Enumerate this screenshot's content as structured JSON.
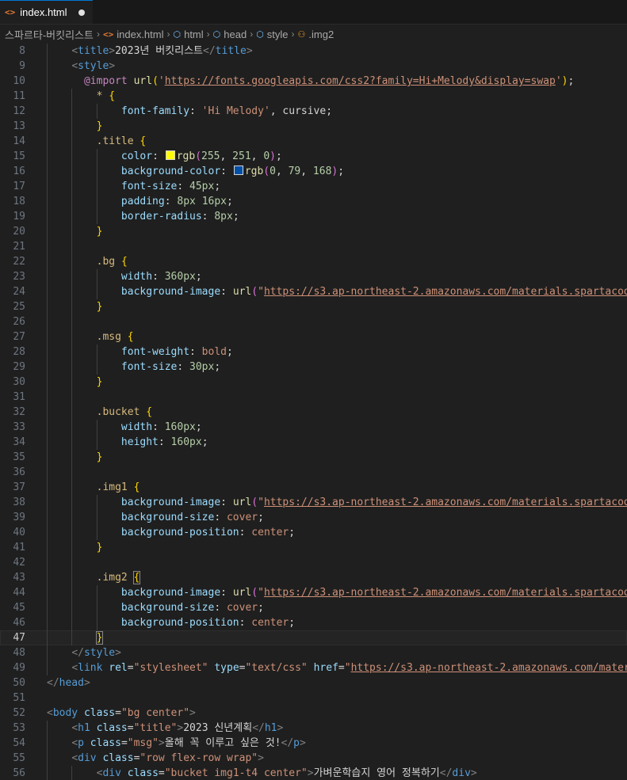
{
  "tab": {
    "filename": "index.html",
    "icon": "<>"
  },
  "breadcrumb": [
    {
      "label": "스파르타-버킷리스트",
      "icon": ""
    },
    {
      "label": "index.html",
      "icon": "html-file-icon"
    },
    {
      "label": "html",
      "icon": "cube-icon"
    },
    {
      "label": "head",
      "icon": "cube-icon"
    },
    {
      "label": "style",
      "icon": "cube-icon"
    },
    {
      "label": ".img2",
      "icon": "symbol-class-icon"
    }
  ],
  "colors": {
    "swatch_yellow": "#fffb00",
    "swatch_blue": "#004fa8",
    "accent": "#0078d4"
  },
  "editor": {
    "current_line": "47",
    "lines": [
      {
        "n": "8",
        "ind": 1,
        "t": [
          [
            "t-punc",
            "<"
          ],
          [
            "t-tag",
            "title"
          ],
          [
            "t-punc",
            ">"
          ],
          [
            "t-text",
            "2023년 버킷리스트"
          ],
          [
            "t-punc",
            "</"
          ],
          [
            "t-tag",
            "title"
          ],
          [
            "t-punc",
            ">"
          ]
        ]
      },
      {
        "n": "9",
        "ind": 1,
        "t": [
          [
            "t-punc",
            "<"
          ],
          [
            "t-tag",
            "style"
          ],
          [
            "t-punc",
            ">"
          ]
        ]
      },
      {
        "n": "10",
        "ind": 1,
        "pre": "  ",
        "t": [
          [
            "t-at",
            "@import"
          ],
          [
            "t-def",
            " "
          ],
          [
            "t-fn",
            "url"
          ],
          [
            "t-br1",
            "("
          ],
          [
            "t-str",
            "'"
          ],
          [
            "t-url",
            "https://fonts.googleapis.com/css2?family=Hi+Melody&display=swap"
          ],
          [
            "t-str",
            "'"
          ],
          [
            "t-br1",
            ")"
          ],
          [
            "t-def",
            ";"
          ]
        ]
      },
      {
        "n": "11",
        "ind": 2,
        "t": [
          [
            "t-sel",
            "*"
          ],
          [
            "t-def",
            " "
          ],
          [
            "t-br1",
            "{"
          ]
        ]
      },
      {
        "n": "12",
        "ind": 3,
        "t": [
          [
            "t-prop",
            "font-family"
          ],
          [
            "t-def",
            ": "
          ],
          [
            "t-val",
            "'Hi Melody'"
          ],
          [
            "t-def",
            ", "
          ],
          [
            "t-def",
            "cursive"
          ],
          [
            "t-def",
            ";"
          ]
        ]
      },
      {
        "n": "13",
        "ind": 2,
        "t": [
          [
            "t-br1",
            "}"
          ]
        ]
      },
      {
        "n": "14",
        "ind": 2,
        "t": [
          [
            "t-sel",
            ".title"
          ],
          [
            "t-def",
            " "
          ],
          [
            "t-br1",
            "{"
          ]
        ]
      },
      {
        "n": "15",
        "ind": 3,
        "t": [
          [
            "t-prop",
            "color"
          ],
          [
            "t-def",
            ": "
          ],
          [
            "swatch",
            "#fffb00"
          ],
          [
            "t-fn",
            "rgb"
          ],
          [
            "t-br2",
            "("
          ],
          [
            "t-num",
            "255"
          ],
          [
            "t-def",
            ", "
          ],
          [
            "t-num",
            "251"
          ],
          [
            "t-def",
            ", "
          ],
          [
            "t-num",
            "0"
          ],
          [
            "t-br2",
            ")"
          ],
          [
            "t-def",
            ";"
          ]
        ]
      },
      {
        "n": "16",
        "ind": 3,
        "t": [
          [
            "t-prop",
            "background-color"
          ],
          [
            "t-def",
            ": "
          ],
          [
            "swatch",
            "#004fa8"
          ],
          [
            "t-fn",
            "rgb"
          ],
          [
            "t-br2",
            "("
          ],
          [
            "t-num",
            "0"
          ],
          [
            "t-def",
            ", "
          ],
          [
            "t-num",
            "79"
          ],
          [
            "t-def",
            ", "
          ],
          [
            "t-num",
            "168"
          ],
          [
            "t-br2",
            ")"
          ],
          [
            "t-def",
            ";"
          ]
        ]
      },
      {
        "n": "17",
        "ind": 3,
        "t": [
          [
            "t-prop",
            "font-size"
          ],
          [
            "t-def",
            ": "
          ],
          [
            "t-num",
            "45px"
          ],
          [
            "t-def",
            ";"
          ]
        ]
      },
      {
        "n": "18",
        "ind": 3,
        "t": [
          [
            "t-prop",
            "padding"
          ],
          [
            "t-def",
            ": "
          ],
          [
            "t-num",
            "8px"
          ],
          [
            "t-def",
            " "
          ],
          [
            "t-num",
            "16px"
          ],
          [
            "t-def",
            ";"
          ]
        ]
      },
      {
        "n": "19",
        "ind": 3,
        "t": [
          [
            "t-prop",
            "border-radius"
          ],
          [
            "t-def",
            ": "
          ],
          [
            "t-num",
            "8px"
          ],
          [
            "t-def",
            ";"
          ]
        ]
      },
      {
        "n": "20",
        "ind": 2,
        "t": [
          [
            "t-br1",
            "}"
          ]
        ]
      },
      {
        "n": "21",
        "ind": 2,
        "t": []
      },
      {
        "n": "22",
        "ind": 2,
        "t": [
          [
            "t-sel",
            ".bg"
          ],
          [
            "t-def",
            " "
          ],
          [
            "t-br1",
            "{"
          ]
        ]
      },
      {
        "n": "23",
        "ind": 3,
        "t": [
          [
            "t-prop",
            "width"
          ],
          [
            "t-def",
            ": "
          ],
          [
            "t-num",
            "360px"
          ],
          [
            "t-def",
            ";"
          ]
        ]
      },
      {
        "n": "24",
        "ind": 3,
        "t": [
          [
            "t-prop",
            "background-image"
          ],
          [
            "t-def",
            ": "
          ],
          [
            "t-fn",
            "url"
          ],
          [
            "t-br2",
            "("
          ],
          [
            "t-str",
            "\""
          ],
          [
            "t-url",
            "https://s3.ap-northeast-2.amazonaws.com/materials.spartacodingclub.kr"
          ]
        ]
      },
      {
        "n": "25",
        "ind": 2,
        "t": [
          [
            "t-br1",
            "}"
          ]
        ]
      },
      {
        "n": "26",
        "ind": 2,
        "t": []
      },
      {
        "n": "27",
        "ind": 2,
        "t": [
          [
            "t-sel",
            ".msg"
          ],
          [
            "t-def",
            " "
          ],
          [
            "t-br1",
            "{"
          ]
        ]
      },
      {
        "n": "28",
        "ind": 3,
        "t": [
          [
            "t-prop",
            "font-weight"
          ],
          [
            "t-def",
            ": "
          ],
          [
            "t-val",
            "bold"
          ],
          [
            "t-def",
            ";"
          ]
        ]
      },
      {
        "n": "29",
        "ind": 3,
        "t": [
          [
            "t-prop",
            "font-size"
          ],
          [
            "t-def",
            ": "
          ],
          [
            "t-num",
            "30px"
          ],
          [
            "t-def",
            ";"
          ]
        ]
      },
      {
        "n": "30",
        "ind": 2,
        "t": [
          [
            "t-br1",
            "}"
          ]
        ]
      },
      {
        "n": "31",
        "ind": 2,
        "t": []
      },
      {
        "n": "32",
        "ind": 2,
        "t": [
          [
            "t-sel",
            ".bucket"
          ],
          [
            "t-def",
            " "
          ],
          [
            "t-br1",
            "{"
          ]
        ]
      },
      {
        "n": "33",
        "ind": 3,
        "t": [
          [
            "t-prop",
            "width"
          ],
          [
            "t-def",
            ": "
          ],
          [
            "t-num",
            "160px"
          ],
          [
            "t-def",
            ";"
          ]
        ]
      },
      {
        "n": "34",
        "ind": 3,
        "t": [
          [
            "t-prop",
            "height"
          ],
          [
            "t-def",
            ": "
          ],
          [
            "t-num",
            "160px"
          ],
          [
            "t-def",
            ";"
          ]
        ]
      },
      {
        "n": "35",
        "ind": 2,
        "t": [
          [
            "t-br1",
            "}"
          ]
        ]
      },
      {
        "n": "36",
        "ind": 2,
        "t": []
      },
      {
        "n": "37",
        "ind": 2,
        "t": [
          [
            "t-sel",
            ".img1"
          ],
          [
            "t-def",
            " "
          ],
          [
            "t-br1",
            "{"
          ]
        ]
      },
      {
        "n": "38",
        "ind": 3,
        "t": [
          [
            "t-prop",
            "background-image"
          ],
          [
            "t-def",
            ": "
          ],
          [
            "t-fn",
            "url"
          ],
          [
            "t-br2",
            "("
          ],
          [
            "t-str",
            "\""
          ],
          [
            "t-url",
            "https://s3.ap-northeast-2.amazonaws.com/materials.spartacodingclub.kr"
          ]
        ]
      },
      {
        "n": "39",
        "ind": 3,
        "t": [
          [
            "t-prop",
            "background-size"
          ],
          [
            "t-def",
            ": "
          ],
          [
            "t-val",
            "cover"
          ],
          [
            "t-def",
            ";"
          ]
        ]
      },
      {
        "n": "40",
        "ind": 3,
        "t": [
          [
            "t-prop",
            "background-position"
          ],
          [
            "t-def",
            ": "
          ],
          [
            "t-val",
            "center"
          ],
          [
            "t-def",
            ";"
          ]
        ]
      },
      {
        "n": "41",
        "ind": 2,
        "t": [
          [
            "t-br1",
            "}"
          ]
        ]
      },
      {
        "n": "42",
        "ind": 2,
        "t": []
      },
      {
        "n": "43",
        "ind": 2,
        "t": [
          [
            "t-sel",
            ".img2"
          ],
          [
            "t-def",
            " "
          ],
          [
            "t-br1 bracket-box",
            "{"
          ]
        ]
      },
      {
        "n": "44",
        "ind": 3,
        "t": [
          [
            "t-prop",
            "background-image"
          ],
          [
            "t-def",
            ": "
          ],
          [
            "t-fn",
            "url"
          ],
          [
            "t-br2",
            "("
          ],
          [
            "t-str",
            "\""
          ],
          [
            "t-url",
            "https://s3.ap-northeast-2.amazonaws.com/materials.spartacodingclub.kr"
          ]
        ]
      },
      {
        "n": "45",
        "ind": 3,
        "t": [
          [
            "t-prop",
            "background-size"
          ],
          [
            "t-def",
            ": "
          ],
          [
            "t-val",
            "cover"
          ],
          [
            "t-def",
            ";"
          ]
        ]
      },
      {
        "n": "46",
        "ind": 3,
        "t": [
          [
            "t-prop",
            "background-position"
          ],
          [
            "t-def",
            ": "
          ],
          [
            "t-val",
            "center"
          ],
          [
            "t-def",
            ";"
          ]
        ]
      },
      {
        "n": "47",
        "ind": 2,
        "t": [
          [
            "t-br1 bracket-box",
            "}"
          ]
        ]
      },
      {
        "n": "48",
        "ind": 1,
        "t": [
          [
            "t-punc",
            "</"
          ],
          [
            "t-tag",
            "style"
          ],
          [
            "t-punc",
            ">"
          ]
        ]
      },
      {
        "n": "49",
        "ind": 1,
        "t": [
          [
            "t-punc",
            "<"
          ],
          [
            "t-tag",
            "link"
          ],
          [
            "t-def",
            " "
          ],
          [
            "t-attr",
            "rel"
          ],
          [
            "t-def",
            "="
          ],
          [
            "t-str",
            "\"stylesheet\""
          ],
          [
            "t-def",
            " "
          ],
          [
            "t-attr",
            "type"
          ],
          [
            "t-def",
            "="
          ],
          [
            "t-str",
            "\"text/css\""
          ],
          [
            "t-def",
            " "
          ],
          [
            "t-attr",
            "href"
          ],
          [
            "t-def",
            "="
          ],
          [
            "t-str",
            "\""
          ],
          [
            "t-url",
            "https://s3.ap-northeast-2.amazonaws.com/materials"
          ]
        ]
      },
      {
        "n": "50",
        "ind": 0,
        "t": [
          [
            "t-punc",
            "</"
          ],
          [
            "t-tag",
            "head"
          ],
          [
            "t-punc",
            ">"
          ]
        ]
      },
      {
        "n": "51",
        "ind": 0,
        "t": []
      },
      {
        "n": "52",
        "ind": 0,
        "t": [
          [
            "t-punc",
            "<"
          ],
          [
            "t-tag",
            "body"
          ],
          [
            "t-def",
            " "
          ],
          [
            "t-attr",
            "class"
          ],
          [
            "t-def",
            "="
          ],
          [
            "t-str",
            "\"bg center\""
          ],
          [
            "t-punc",
            ">"
          ]
        ]
      },
      {
        "n": "53",
        "ind": 1,
        "t": [
          [
            "t-punc",
            "<"
          ],
          [
            "t-tag",
            "h1"
          ],
          [
            "t-def",
            " "
          ],
          [
            "t-attr",
            "class"
          ],
          [
            "t-def",
            "="
          ],
          [
            "t-str",
            "\"title\""
          ],
          [
            "t-punc",
            ">"
          ],
          [
            "t-text",
            "2023 신년계획"
          ],
          [
            "t-punc",
            "</"
          ],
          [
            "t-tag",
            "h1"
          ],
          [
            "t-punc",
            ">"
          ]
        ]
      },
      {
        "n": "54",
        "ind": 1,
        "t": [
          [
            "t-punc",
            "<"
          ],
          [
            "t-tag",
            "p"
          ],
          [
            "t-def",
            " "
          ],
          [
            "t-attr",
            "class"
          ],
          [
            "t-def",
            "="
          ],
          [
            "t-str",
            "\"msg\""
          ],
          [
            "t-punc",
            ">"
          ],
          [
            "t-text",
            "올해 꼭 이루고 싶은 것!"
          ],
          [
            "t-punc",
            "</"
          ],
          [
            "t-tag",
            "p"
          ],
          [
            "t-punc",
            ">"
          ]
        ]
      },
      {
        "n": "55",
        "ind": 1,
        "t": [
          [
            "t-punc",
            "<"
          ],
          [
            "t-tag",
            "div"
          ],
          [
            "t-def",
            " "
          ],
          [
            "t-attr",
            "class"
          ],
          [
            "t-def",
            "="
          ],
          [
            "t-str",
            "\"row flex-row wrap\""
          ],
          [
            "t-punc",
            ">"
          ]
        ]
      },
      {
        "n": "56",
        "ind": 2,
        "t": [
          [
            "t-punc",
            "<"
          ],
          [
            "t-tag",
            "div"
          ],
          [
            "t-def",
            " "
          ],
          [
            "t-attr",
            "class"
          ],
          [
            "t-def",
            "="
          ],
          [
            "t-str",
            "\"bucket img1-t4 center\""
          ],
          [
            "t-punc",
            ">"
          ],
          [
            "t-text",
            "가벼운학습지 영어 정복하기"
          ],
          [
            "t-punc",
            "</"
          ],
          [
            "t-tag",
            "div"
          ],
          [
            "t-punc",
            ">"
          ]
        ]
      }
    ]
  }
}
